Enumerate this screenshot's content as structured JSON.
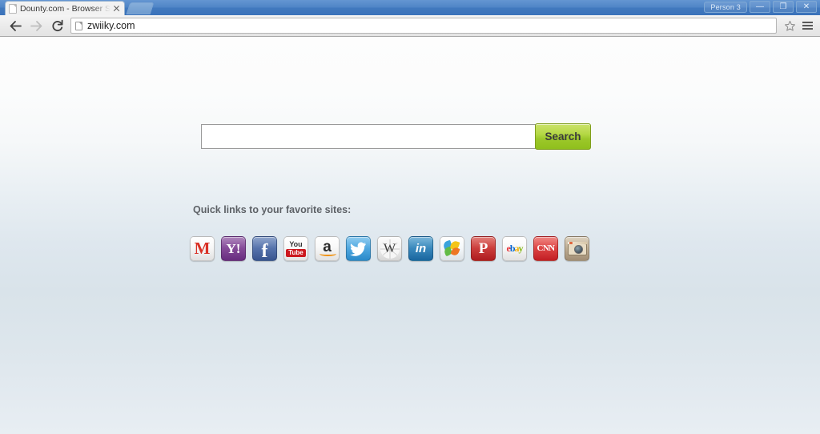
{
  "browser": {
    "tab": {
      "title": "Dounty.com - Browser Se",
      "favicon_icon": "page-icon",
      "close_icon": "close-icon"
    },
    "new_tab_icon": "new-tab-icon",
    "window_controls": {
      "person_label": "Person 3",
      "minimize": "—",
      "maximize": "❐",
      "close": "✕"
    },
    "toolbar": {
      "back_icon": "back-arrow-icon",
      "forward_icon": "forward-arrow-icon",
      "reload_icon": "reload-icon",
      "url": "zwiiky.com",
      "url_favicon_icon": "page-icon",
      "bookmark_icon": "star-icon",
      "menu_icon": "hamburger-menu-icon"
    }
  },
  "page": {
    "search": {
      "value": "",
      "placeholder": "",
      "button_label": "Search"
    },
    "quicklinks": {
      "heading": "Quick links to your favorite sites:",
      "items": [
        {
          "name": "gmail",
          "label": "Gmail",
          "icon": "gmail-icon"
        },
        {
          "name": "yahoo",
          "label": "Y!",
          "icon": "yahoo-icon"
        },
        {
          "name": "facebook",
          "label": "f",
          "icon": "facebook-icon"
        },
        {
          "name": "youtube",
          "label": "You",
          "label2": "Tube",
          "icon": "youtube-icon"
        },
        {
          "name": "amazon",
          "label": "a",
          "icon": "amazon-icon"
        },
        {
          "name": "twitter",
          "label": "🕊",
          "icon": "twitter-icon"
        },
        {
          "name": "wikipedia",
          "label": "W",
          "icon": "wikipedia-icon"
        },
        {
          "name": "linkedin",
          "label": "in",
          "icon": "linkedin-icon"
        },
        {
          "name": "msn",
          "label": "",
          "icon": "msn-butterfly-icon"
        },
        {
          "name": "pinterest",
          "label": "P",
          "icon": "pinterest-icon"
        },
        {
          "name": "ebay",
          "label": "ebay",
          "icon": "ebay-icon"
        },
        {
          "name": "cnn",
          "label": "CNN",
          "icon": "cnn-icon"
        },
        {
          "name": "instagram",
          "label": "",
          "icon": "instagram-icon"
        }
      ]
    }
  },
  "colors": {
    "titlebar": "#4e84c6",
    "search_button_top": "#cbe26a",
    "search_button_bottom": "#8fbf1c",
    "page_bg_top": "#fdfdfd",
    "page_bg_mid": "#dee7ee"
  }
}
